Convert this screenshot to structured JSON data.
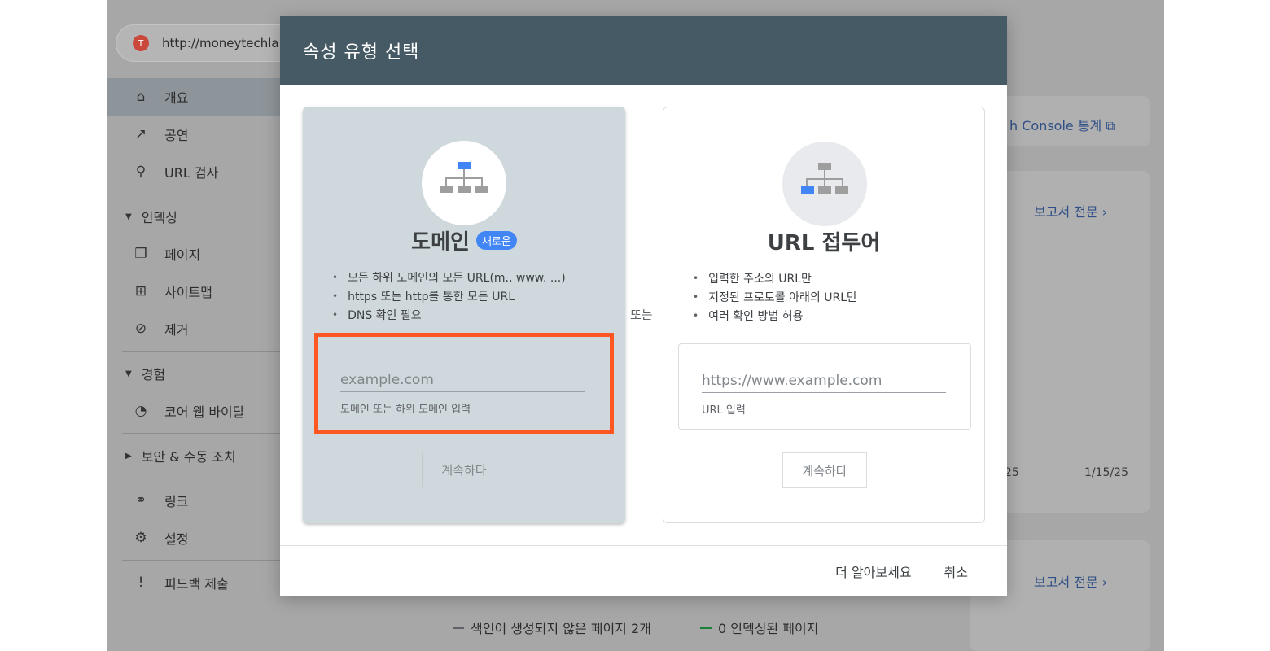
{
  "browser": {
    "url": "http://moneytechla",
    "favicon_glyph": "T"
  },
  "sidebar": {
    "items": [
      {
        "label": "개요",
        "icon": "home-icon",
        "glyph": "⌂",
        "active": true
      },
      {
        "label": "공연",
        "icon": "trending-up-icon",
        "glyph": "↗"
      },
      {
        "label": "URL 검사",
        "icon": "search-icon",
        "glyph": "⚲"
      }
    ],
    "sections": [
      {
        "label": "인덱싱",
        "items": [
          {
            "label": "페이지",
            "icon": "pages-icon",
            "glyph": "❐"
          },
          {
            "label": "사이트맵",
            "icon": "sitemap-icon",
            "glyph": "⊞"
          },
          {
            "label": "제거",
            "icon": "visibility-off-icon",
            "glyph": "⊘"
          }
        ]
      },
      {
        "label": "경험",
        "items": [
          {
            "label": "코어 웹 바이탈",
            "icon": "speed-icon",
            "glyph": "◔"
          }
        ]
      },
      {
        "label": "보안 & 수동 조치",
        "collapsed": true,
        "items": []
      }
    ],
    "bottom_items": [
      {
        "label": "링크",
        "icon": "links-icon",
        "glyph": "⚭"
      },
      {
        "label": "설정",
        "icon": "settings-icon",
        "glyph": "⚙"
      }
    ],
    "feedback": {
      "label": "피드백 제출",
      "icon": "feedback-icon",
      "glyph": "!"
    }
  },
  "background": {
    "console_link": "h Console 통계",
    "report_link_1": "보고서 전문",
    "report_link_2": "보고서 전문",
    "tick_1": "25",
    "tick_2": "1/15/25",
    "legend_1": "색인이 생성되지 않은 페이지 2개",
    "legend_2": "0 인덱싱된 페이지",
    "legend_1_color": "#5f6368",
    "legend_2_color": "#188038"
  },
  "modal": {
    "title": "속성 유형 선택",
    "or_label": "또는",
    "domain": {
      "title": "도메인",
      "badge": "새로운",
      "bullets": [
        "모든 하위 도메인의 모든 URL(m., www. ...)",
        "https 또는 http를 통한 모든 URL",
        "DNS 확인 필요"
      ],
      "input_placeholder": "example.com",
      "input_value": "",
      "help": "도메인 또는 하위 도메인 입력",
      "continue": "계속하다"
    },
    "url_prefix": {
      "title": "URL 접두어",
      "bullets": [
        "입력한 주소의 URL만",
        "지정된 프로토콜 아래의 URL만",
        "여러 확인 방법 허용"
      ],
      "input_placeholder": "https://www.example.com",
      "input_value": "",
      "help": "URL 입력",
      "continue": "계속하다"
    },
    "footer": {
      "learn_more": "더 알아보세요",
      "cancel": "취소"
    }
  },
  "colors": {
    "header": "#455a64",
    "highlight": "#ff5722",
    "accent": "#4285f4",
    "selected_card": "#cfd8dc"
  }
}
